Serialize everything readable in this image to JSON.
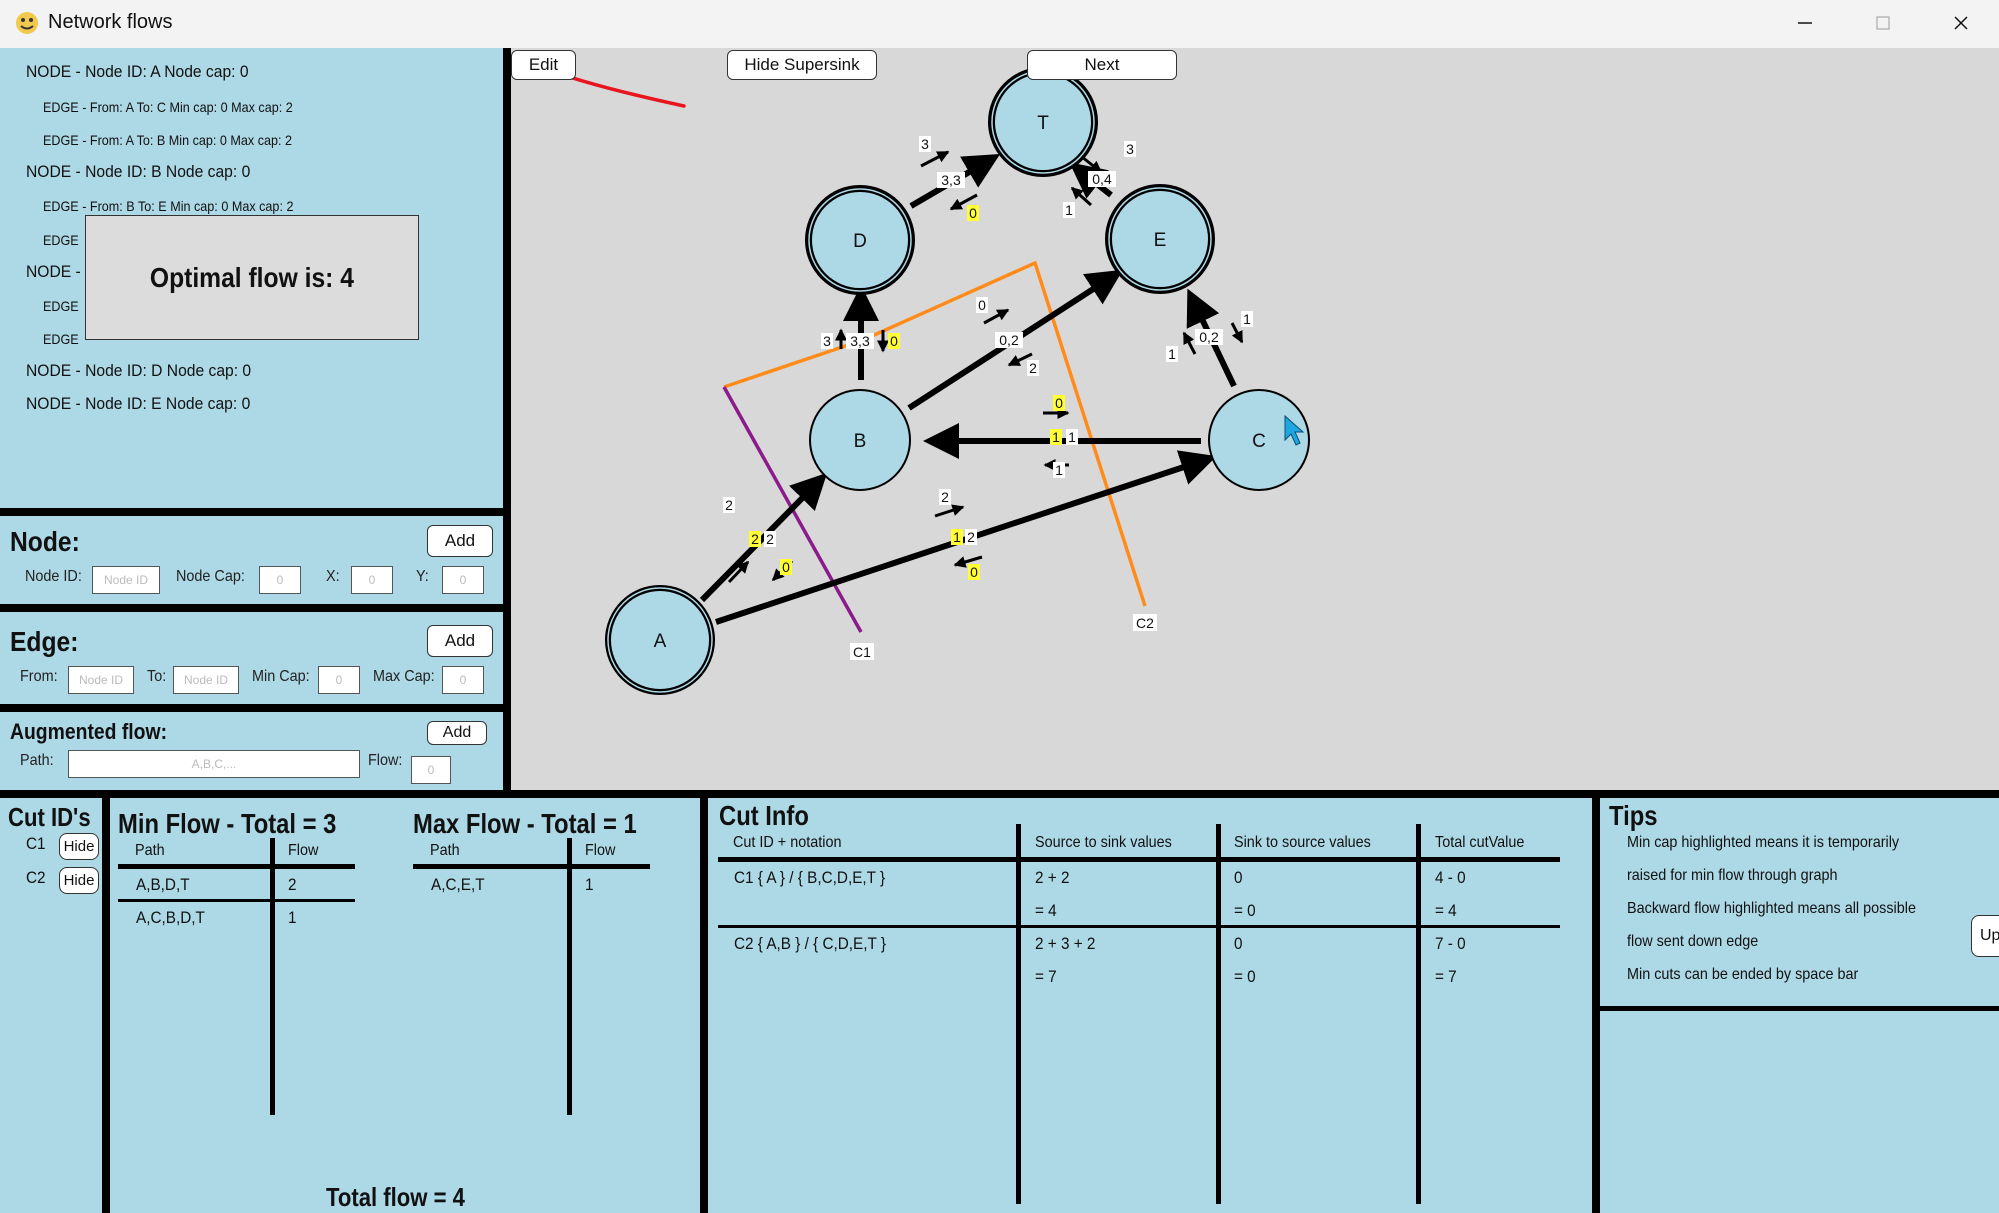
{
  "window": {
    "title": "Network flows"
  },
  "node_list": {
    "lines": [
      {
        "kind": "node",
        "text": "NODE - Node ID: A Node cap: 0"
      },
      {
        "kind": "edge",
        "text": "EDGE - From: A To: C Min cap: 0 Max cap: 2"
      },
      {
        "kind": "edge",
        "text": "EDGE - From: A To: B Min cap: 0 Max cap: 2"
      },
      {
        "kind": "node",
        "text": "NODE - Node ID: B Node cap: 0"
      },
      {
        "kind": "edge",
        "text": "EDGE - From: B To: E Min cap: 0 Max cap: 2"
      },
      {
        "kind": "edge",
        "text": "EDGE"
      },
      {
        "kind": "node",
        "text": "NODE -"
      },
      {
        "kind": "edge",
        "text": "EDGE"
      },
      {
        "kind": "edge",
        "text": "EDGE"
      },
      {
        "kind": "node",
        "text": "NODE - Node ID: D Node cap: 0"
      },
      {
        "kind": "node",
        "text": "NODE - Node ID: E Node cap: 0"
      }
    ]
  },
  "popup": {
    "text": "Optimal flow is: 4"
  },
  "node_form": {
    "title": "Node:",
    "add": "Add",
    "id_label": "Node ID:",
    "id_placeholder": "Node ID",
    "cap_label": "Node Cap:",
    "cap_value": "0",
    "x_label": "X:",
    "x_value": "0",
    "y_label": "Y:",
    "y_value": "0"
  },
  "edge_form": {
    "title": "Edge:",
    "add": "Add",
    "from_label": "From:",
    "from_placeholder": "Node ID",
    "to_label": "To:",
    "to_placeholder": "Node ID",
    "min_label": "Min Cap:",
    "min_value": "0",
    "max_label": "Max Cap:",
    "max_value": "0"
  },
  "aug_form": {
    "title": "Augmented flow:",
    "add": "Add",
    "path_label": "Path:",
    "path_placeholder": "A,B,C,...",
    "flow_label": "Flow:",
    "flow_value": "0"
  },
  "toolbar": {
    "edit": "Edit",
    "hide_supersink": "Hide Supersink",
    "next": "Next"
  },
  "graph": {
    "nodes": [
      {
        "id": "T",
        "label": "T"
      },
      {
        "id": "D",
        "label": "D"
      },
      {
        "id": "E",
        "label": "E"
      },
      {
        "id": "B",
        "label": "B"
      },
      {
        "id": "C",
        "label": "C"
      },
      {
        "id": "A",
        "label": "A"
      }
    ],
    "cut_labels": [
      "C1",
      "C2"
    ],
    "edge_labels": [
      {
        "t": "3"
      },
      {
        "t": "3,3"
      },
      {
        "t": "0",
        "hl": true
      },
      {
        "t": "3"
      },
      {
        "t": "0,4"
      },
      {
        "t": "1"
      },
      {
        "t": "3"
      },
      {
        "t": "3,3"
      },
      {
        "t": "0",
        "hl": true
      },
      {
        "t": "0"
      },
      {
        "t": "0,2"
      },
      {
        "t": "2"
      },
      {
        "t": "1"
      },
      {
        "t": "0,2"
      },
      {
        "t": "1"
      },
      {
        "t": "0",
        "hl": true
      },
      {
        "t": "1",
        "hl": true
      },
      {
        "t": "1"
      },
      {
        "t": "1"
      },
      {
        "t": "2"
      },
      {
        "t": "2",
        "hl": true
      },
      {
        "t": "2"
      },
      {
        "t": "0",
        "hl": true
      },
      {
        "t": "2"
      },
      {
        "t": "1",
        "hl": true
      },
      {
        "t": "2"
      },
      {
        "t": "0",
        "hl": true
      }
    ]
  },
  "cut_ids": {
    "title": "Cut ID's",
    "items": [
      {
        "label": "C1",
        "button": "Hide"
      },
      {
        "label": "C2",
        "button": "Hide"
      }
    ]
  },
  "min_flow": {
    "title": "Min Flow - Total = 3",
    "headers": [
      "Path",
      "Flow"
    ],
    "rows": [
      [
        "A,B,D,T",
        "2"
      ],
      [
        "A,C,B,D,T",
        "1"
      ]
    ]
  },
  "max_flow": {
    "title": "Max Flow - Total = 1",
    "headers": [
      "Path",
      "Flow"
    ],
    "rows": [
      [
        "A,C,E,T",
        "1"
      ]
    ]
  },
  "total_flow": "Total flow = 4",
  "cut_info": {
    "title": "Cut Info",
    "headers": [
      "Cut ID + notation",
      "Source to sink values",
      "Sink to source values",
      "Total cutValue"
    ],
    "rows": [
      [
        "C1 { A } / { B,C,D,E,T }",
        "2 + 2",
        "0",
        "4 - 0"
      ],
      [
        "",
        "= 4",
        "= 0",
        "= 4"
      ],
      [
        "C2 { A,B } / { C,D,E,T }",
        "2 + 3 + 2",
        "0",
        "7 - 0"
      ],
      [
        "",
        "= 7",
        "= 0",
        "= 7"
      ]
    ]
  },
  "tips": {
    "title": "Tips",
    "lines": [
      "Min cap highlighted means it is temporarily",
      "raised for min flow through graph",
      "Backward flow highlighted means all possible",
      "flow sent down edge",
      "Min cuts can be ended by space bar"
    ],
    "button": "Up"
  },
  "colors": {
    "panel": "#add8e6",
    "canvas": "#d8d8d8",
    "node_fill": "#add8e6",
    "cut_c1": "#8b1a8b",
    "cut_c2": "#ff8c1a",
    "highlight": "#ffff33",
    "annotation": "#e8141e"
  }
}
